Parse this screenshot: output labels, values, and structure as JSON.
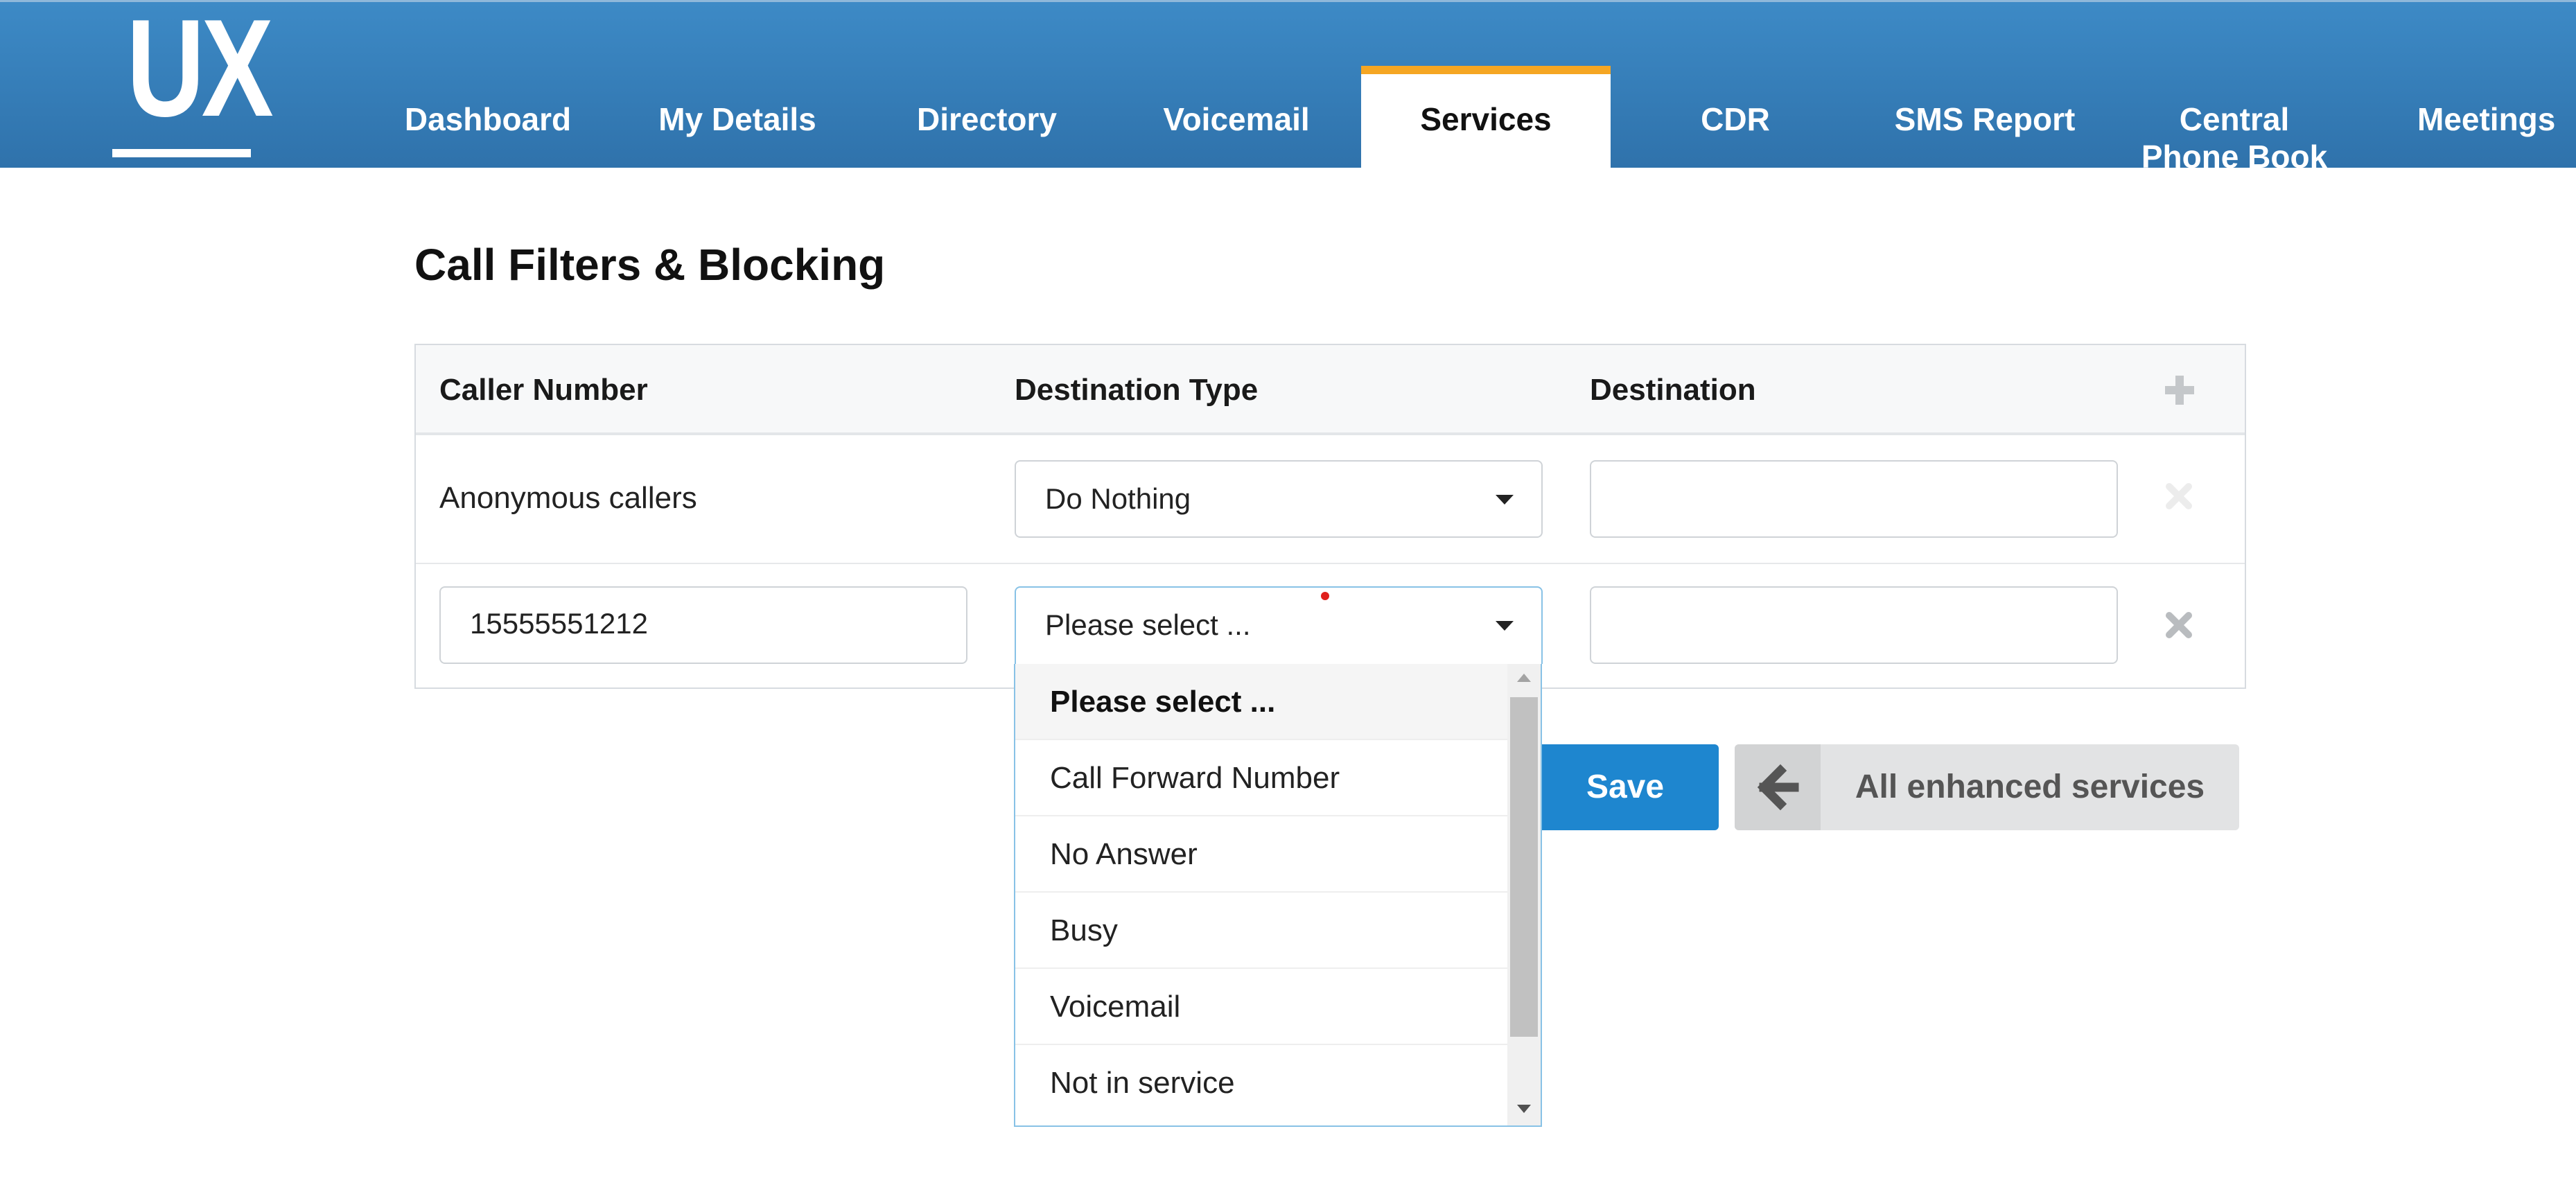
{
  "brand": {
    "logo_text": "UX",
    "accent_color": "#f5a623",
    "header_color": "#3585c0"
  },
  "nav": {
    "items": [
      {
        "label": "Dashboard"
      },
      {
        "label": "My Details"
      },
      {
        "label": "Directory"
      },
      {
        "label": "Voicemail"
      },
      {
        "label": "Services",
        "active": true
      },
      {
        "label": "CDR"
      },
      {
        "label": "SMS Report"
      },
      {
        "label": "Central Phone Book"
      },
      {
        "label": "Meetings"
      }
    ]
  },
  "page": {
    "title": "Call Filters & Blocking"
  },
  "table": {
    "columns": [
      "Caller Number",
      "Destination Type",
      "Destination"
    ],
    "add_icon": "plus-icon",
    "remove_icon": "close-icon",
    "rows": [
      {
        "caller": "Anonymous callers",
        "destination_type": "Do Nothing",
        "destination": ""
      },
      {
        "caller": "15555551212",
        "destination_type": "Please select ...",
        "destination": ""
      }
    ]
  },
  "dropdown": {
    "selected": "Please select ...",
    "options": [
      "Please select ...",
      "Call Forward Number",
      "No Answer",
      "Busy",
      "Voicemail",
      "Not in service"
    ]
  },
  "actions": {
    "save_label": "Save",
    "back_label": "All enhanced services",
    "back_icon": "arrow-left-icon"
  }
}
